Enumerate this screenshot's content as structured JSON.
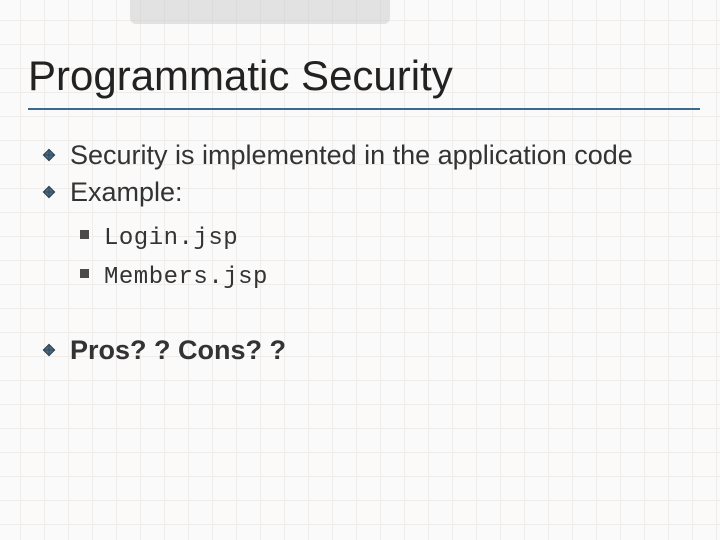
{
  "title": "Programmatic Security",
  "bullet1": "Security is implemented in the application code",
  "bullet2": "Example:",
  "sub1": "Login.jsp",
  "sub2": "Members.jsp",
  "bullet3": "Pros? ? Cons? ?"
}
